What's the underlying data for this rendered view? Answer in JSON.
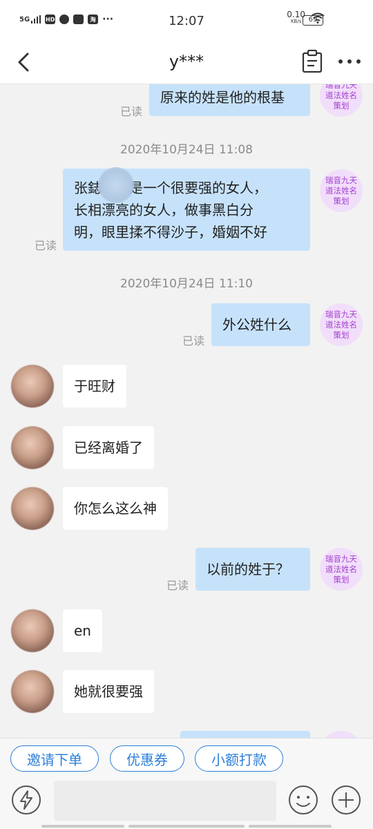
{
  "status_bar": {
    "network": "5G",
    "time": "12:07",
    "speed_value": "0.10",
    "speed_unit": "KB/s",
    "battery": "69"
  },
  "header": {
    "title": "y***"
  },
  "agent_avatar_text": "瑞音九天道法姓名策划",
  "messages": [
    {
      "side": "right",
      "text": "原来的姓是他的根基",
      "status": "已读"
    },
    {
      "type": "time",
      "text": "2020年10月24日 11:08"
    },
    {
      "side": "right",
      "lines": [
        "张鋕　　是一个很要强的女人，",
        "长相漂亮的女人，做事黑白分",
        "明，眼里揉不得沙子，婚姻不好"
      ],
      "status": "已读"
    },
    {
      "type": "time",
      "text": "2020年10月24日 11:10"
    },
    {
      "side": "right",
      "text": "外公姓什么",
      "status": "已读"
    },
    {
      "side": "left",
      "text": "于旺财"
    },
    {
      "side": "left",
      "text": "已经离婚了"
    },
    {
      "side": "left",
      "text": "你怎么这么神"
    },
    {
      "side": "right",
      "text": "以前的姓于？",
      "status": "已读"
    },
    {
      "side": "left",
      "text": "en"
    },
    {
      "side": "left",
      "text": "她就很要强"
    }
  ],
  "quick_actions": [
    "邀请下单",
    "优惠券",
    "小额打款"
  ],
  "input": {
    "placeholder": ""
  },
  "colors": {
    "accent": "#2d7fd9",
    "outgoing_bubble": "#c6e2fb",
    "incoming_bubble": "#ffffff",
    "background": "#f2f2f2",
    "avatar_text": "#a240cc"
  }
}
